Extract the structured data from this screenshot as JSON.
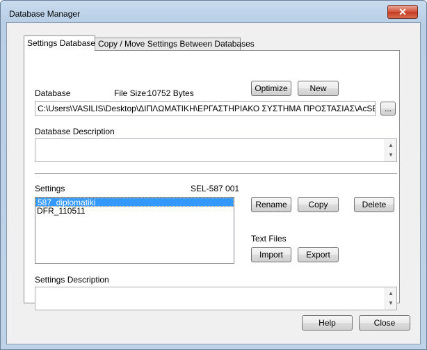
{
  "window": {
    "title": "Database Manager",
    "close_glyph": "✕"
  },
  "tabs": [
    {
      "label": "Settings Database",
      "active": true
    },
    {
      "label": "Copy / Move Settings Between Databases",
      "active": false
    }
  ],
  "database": {
    "label": "Database",
    "file_size_label": "File Size:",
    "file_size_value": "10752 Bytes",
    "path": "C:\\Users\\VASILIS\\Desktop\\ΔΙΠΛΩΜΑΤΙΚΗ\\ΕΡΓΑΣΤΗΡΙΑΚΟ ΣΥΣΤΗΜΑ ΠΡΟΣΤΑΣΙΑΣ\\AcSELerator\\Ac",
    "browse_label": "...",
    "optimize_label": "Optimize",
    "new_label": "New",
    "description_label": "Database Description",
    "description_value": ""
  },
  "settings": {
    "label": "Settings",
    "device": "SEL-587 001",
    "items": [
      {
        "name": "587_diplomatiki",
        "selected": true
      },
      {
        "name": "DFR_110511",
        "selected": false
      }
    ],
    "rename_label": "Rename",
    "copy_label": "Copy",
    "delete_label": "Delete",
    "text_files_label": "Text Files",
    "import_label": "Import",
    "export_label": "Export",
    "description_label": "Settings Description",
    "description_value": ""
  },
  "footer": {
    "help_label": "Help",
    "close_label": "Close"
  },
  "scroll_arrows": {
    "up": "▲",
    "down": "▼"
  }
}
